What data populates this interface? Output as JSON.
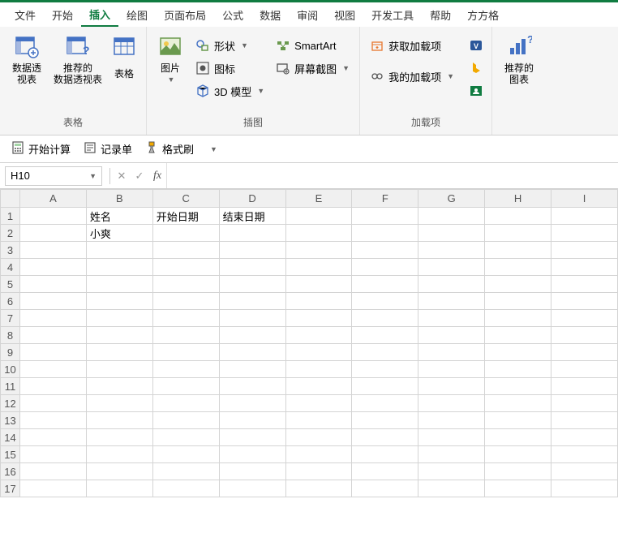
{
  "tabs": [
    "文件",
    "开始",
    "插入",
    "绘图",
    "页面布局",
    "公式",
    "数据",
    "审阅",
    "视图",
    "开发工具",
    "帮助",
    "方方格"
  ],
  "activeTab": 2,
  "ribbon": {
    "group_tables": {
      "label": "表格",
      "pivot": "数据透\n视表",
      "recPivot": "推荐的\n数据透视表",
      "table": "表格"
    },
    "group_illust": {
      "label": "插图",
      "pictures": "图片",
      "shapes": "形状",
      "icons": "图标",
      "model3d": "3D 模型",
      "smartart": "SmartArt",
      "screenshot": "屏幕截图"
    },
    "group_addins": {
      "label": "加载项",
      "getAddins": "获取加载项",
      "myAddins": "我的加载项"
    },
    "group_chart": {
      "recCharts": "推荐的\n图表"
    }
  },
  "qat": {
    "calc": "开始计算",
    "record": "记录单",
    "format": "格式刷"
  },
  "formula": {
    "cellRef": "H10",
    "value": ""
  },
  "columns": [
    "A",
    "B",
    "C",
    "D",
    "E",
    "F",
    "G",
    "H",
    "I"
  ],
  "rows": 17,
  "cells": {
    "1": {
      "B": "姓名",
      "C": "开始日期",
      "D": "结束日期"
    },
    "2": {
      "B": "小爽"
    }
  }
}
